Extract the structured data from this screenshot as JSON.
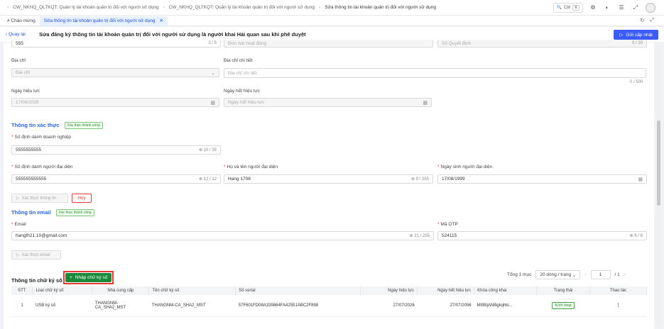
{
  "breadcrumb": [
    "CW_NKHQ_QLTKQT: Quản lý tài khoản quản trị đối với người sử dụng",
    "CW_NKHQ_QLTKQT: Quản lý tài khoản quản trị đối với người sử dụng",
    "Sửa thông tin tài khoản quản trị đối với người sử dụng"
  ],
  "search": {
    "ctrl": "Ctrl",
    "key": "K"
  },
  "tabs": [
    {
      "label": "# Chào mừng"
    },
    {
      "label": "Sửa thông tin tài khoản quản trị đối với người sử dụng"
    }
  ],
  "header": {
    "back": "Quay lại",
    "title": "Sửa đăng ký thông tin tài khoản quản trị đối với người sử dụng là người khai Hải quan sau khi phê duyệt",
    "send": "Gửi cấp nhật"
  },
  "top_partial": {
    "v1": "555",
    "c1": "3 / 5",
    "v2": "Đơn hàt hoạt động",
    "v3": "Số Quyết định",
    "c3": "0 / 20"
  },
  "address": {
    "label": "Địa chỉ",
    "placeholder": "Địa chỉ",
    "detail_label": "Địa chỉ chi tiết",
    "detail_placeholder": "Địa chỉ chi tiết",
    "detail_count": "0 / 500"
  },
  "dates": {
    "eff_label": "Ngày hiệu lực",
    "eff_value": "17/08/2026",
    "exp_label": "Ngày hết hiệu lực",
    "exp_placeholder": "Ngày hết hiệu lực"
  },
  "verify": {
    "title": "Thông tin xác thực",
    "badge": "Xác thực thành công",
    "biz_label": "Số định danh doanh nghiệp",
    "biz_value": "5555555555",
    "biz_count": "10 / 35",
    "rep_id_label": "Số định danh người đại diện",
    "rep_id_value": "555555555555",
    "rep_id_count": "12 / 12",
    "rep_name_label": "Họ và tên người đại diện",
    "rep_name_value": "Hang 1708",
    "rep_name_count": "9 / 255",
    "dob_label": "Ngày sinh người đại diện",
    "dob_value": "17/08/1999",
    "verify_btn": "Xác thực thông tin",
    "cancel_btn": "Hủy"
  },
  "email": {
    "title": "Thông tin email",
    "badge": "Xác thực thành công",
    "email_label": "Email",
    "email_value": "hangth21.10@gmail.com",
    "email_count": "21 / 255",
    "otp_label": "Mã OTP",
    "otp_value": "524115",
    "otp_count": "6 / 6",
    "verify_btn": "Xác thực email"
  },
  "signature": {
    "title": "Thông tin chữ ký số",
    "add_btn": "Nhập chữ ký số",
    "total": "Tổng 1 mục",
    "page_size": "20 dòng / trang",
    "page": "1",
    "pages": "/ 1",
    "columns": [
      "STT",
      "Loại chữ ký số",
      "Nhà cung cấp",
      "Tên chữ ký số",
      "Số serial",
      "Ngày hiệu lực",
      "Ngày hết hiệu lực",
      "Khóa công khai",
      "Trạng thái",
      "Thao tác"
    ],
    "rows": [
      {
        "stt": "1",
        "type": "USB ký số",
        "provider": "THANGNM-CA_SHA2_MST",
        "name": "THANGNM-CA_SHA2_MST",
        "serial": "57F601FD08A339864FA42551ABC2F898",
        "eff": "27/07/2026",
        "exp": "27/07/2056",
        "key": "MIIBIjANBgkqhki...",
        "status": "Kích hoạt",
        "action": "⋮"
      }
    ]
  }
}
